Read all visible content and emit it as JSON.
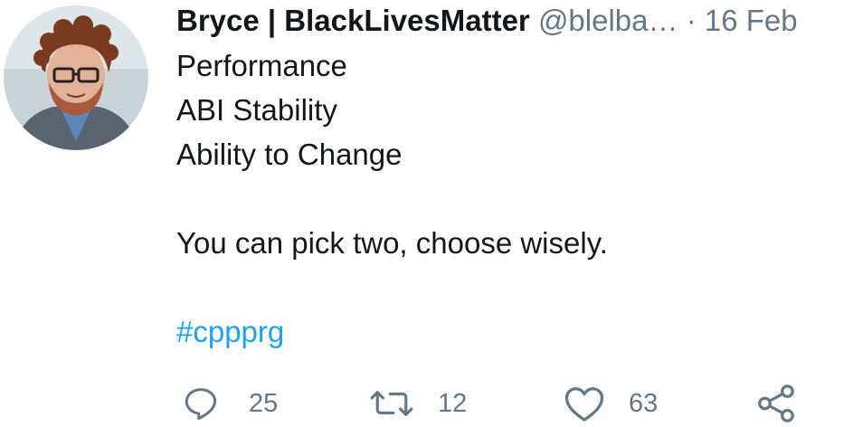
{
  "tweet": {
    "author": {
      "display_name": "Bryce | BlackLivesMatter",
      "handle": "@blelba…",
      "avatar_icon": "user-avatar"
    },
    "separator": "·",
    "date": "16 Feb",
    "lines": [
      "Performance",
      "ABI Stability",
      "Ability to Change"
    ],
    "closing": "You can pick two, choose wisely.",
    "hashtag": "#cppprg",
    "actions": {
      "reply": {
        "icon": "reply-icon",
        "count": "25"
      },
      "retweet": {
        "icon": "retweet-icon",
        "count": "12"
      },
      "like": {
        "icon": "heart-icon",
        "count": "63"
      },
      "share": {
        "icon": "share-icon"
      }
    }
  },
  "colors": {
    "text": "#14171a",
    "muted": "#657786",
    "link": "#1da1f2",
    "background": "#ffffff"
  }
}
